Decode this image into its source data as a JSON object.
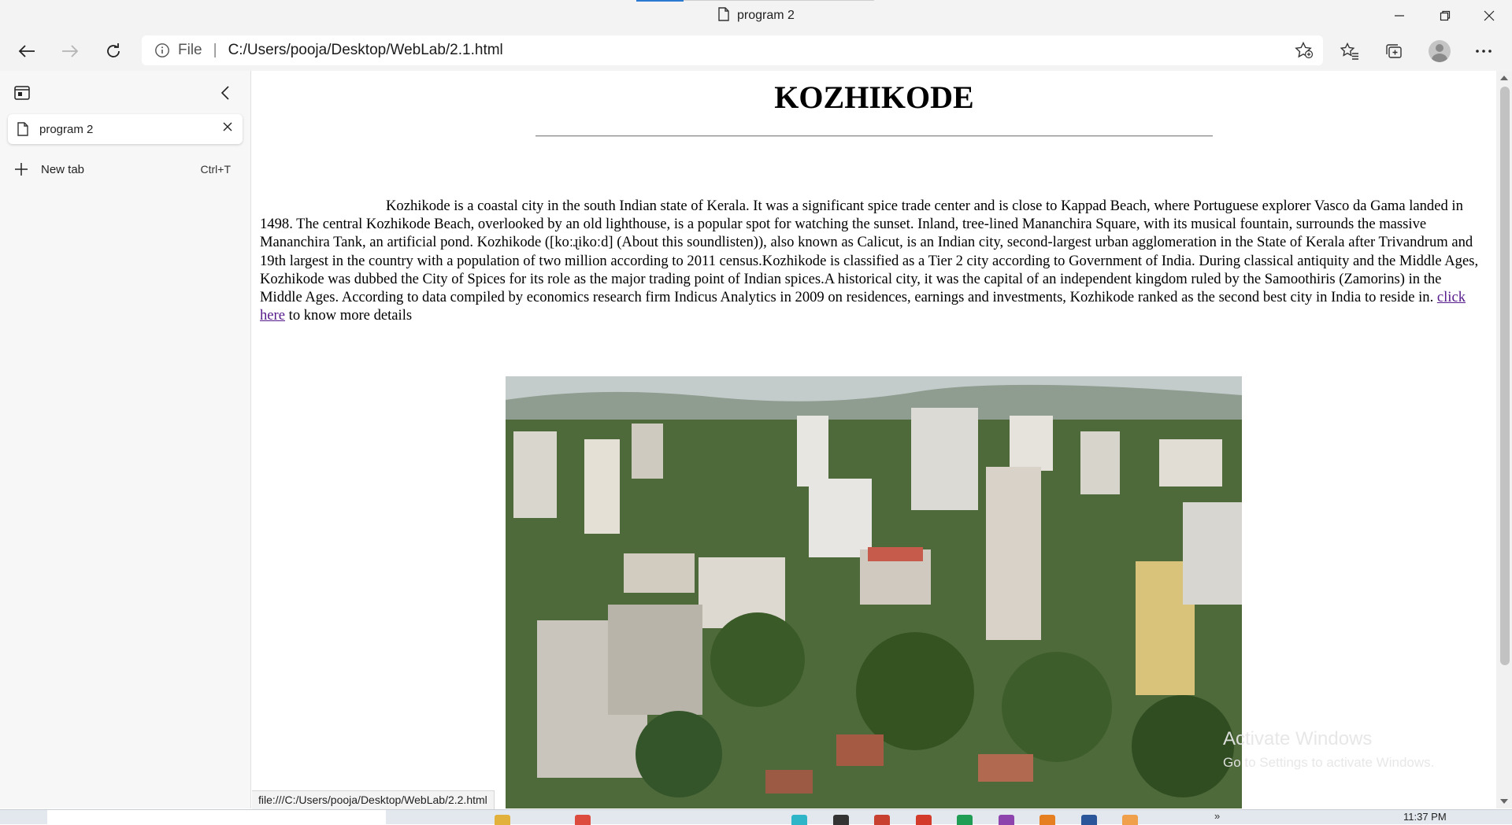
{
  "window": {
    "tab_title": "program 2",
    "controls": [
      "minimize",
      "restore",
      "close"
    ]
  },
  "toolbar": {
    "protocol_label": "File",
    "address": "C:/Users/pooja/Desktop/WebLab/2.1.html"
  },
  "sidebar": {
    "tab_label": "program 2",
    "new_tab_label": "New tab",
    "new_tab_shortcut": "Ctrl+T"
  },
  "page": {
    "heading": "KOZHIKODE",
    "paragraph_text": "Kozhikode is a coastal city in the south Indian state of Kerala. It was a significant spice trade center and is close to Kappad Beach, where Portuguese explorer Vasco da Gama landed in 1498. The central Kozhikode Beach, overlooked by an old lighthouse, is a popular spot for watching the sunset. Inland, tree-lined Mananchira Square, with its musical fountain, surrounds the massive Mananchira Tank, an artificial pond. Kozhikode ([koːɻikoːd] (About this soundlisten)), also known as Calicut, is an Indian city, second-largest urban agglomeration in the State of Kerala after Trivandrum and 19th largest in the country with a population of two million according to 2011 census.Kozhikode is classified as a Tier 2 city according to Government of India. During classical antiquity and the Middle Ages, Kozhikode was dubbed the City of Spices for its role as the major trading point of Indian spices.A historical city, it was the capital of an independent kingdom ruled by the Samoothiris (Zamorins) in the Middle Ages. According to data compiled by economics research firm Indicus Analytics in 2009 on residences, earnings and investments, Kozhikode ranked as the second best city in India to reside in.",
    "link_text": "click here",
    "after_link_text": " to know more details"
  },
  "status": {
    "hover_url": "file:///C:/Users/pooja/Desktop/WebLab/2.2.html"
  },
  "watermark": {
    "line1": "Activate Windows",
    "line2": "Go to Settings to activate Windows."
  },
  "taskbar": {
    "clock": "11:37 PM"
  },
  "colors": {
    "chrome_bg": "#f3f3f3",
    "link_visited": "#551a8b",
    "accent": "#2a7ad1"
  }
}
